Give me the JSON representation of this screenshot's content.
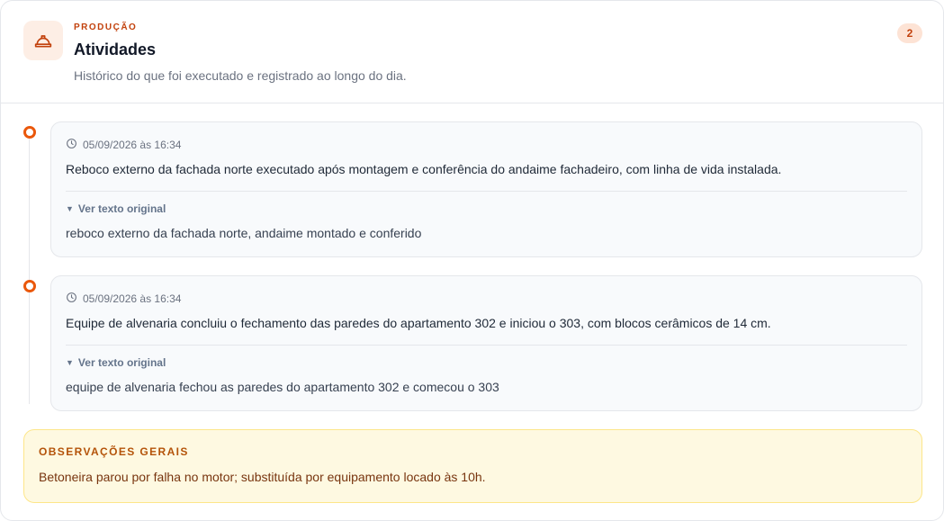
{
  "header": {
    "icon": "hard-hat-icon",
    "eyebrow": "PRODUÇÃO",
    "title": "Atividades",
    "subtitle": "Histórico do que foi executado e registrado ao longo do dia.",
    "count": "2"
  },
  "entries": [
    {
      "timestamp": "05/09/2026 às 16:34",
      "text": "Reboco externo da fachada norte executado após montagem e conferência do andaime fachadeiro, com linha de vida instalada.",
      "toggle_label": "Ver texto original",
      "original": "reboco externo da fachada norte, andaime montado e conferido"
    },
    {
      "timestamp": "05/09/2026 às 16:34",
      "text": "Equipe de alvenaria concluiu o fechamento das paredes do apartamento 302 e iniciou o 303, com blocos cerâmicos de 14 cm.",
      "toggle_label": "Ver texto original",
      "original": "equipe de alvenaria fechou as paredes do apartamento 302 e comecou o 303"
    }
  ],
  "notes": {
    "title": "OBSERVAÇÕES GERAIS",
    "text": "Betoneira parou por falha no motor; substituída por equipamento locado às 10h."
  },
  "colors": {
    "accent": "#ea580c",
    "accent_dark": "#c2410c",
    "notes_bg": "#fef9e1",
    "notes_border": "#fde68a"
  }
}
